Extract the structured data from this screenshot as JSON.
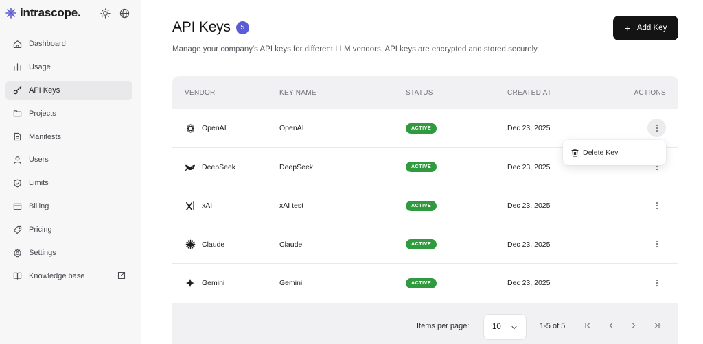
{
  "app": {
    "name": "intrascope."
  },
  "top_icons": [
    "sun-icon",
    "globe-icon"
  ],
  "sidebar": {
    "items": [
      {
        "label": "Dashboard",
        "icon": "home-icon"
      },
      {
        "label": "Usage",
        "icon": "bar-chart-icon"
      },
      {
        "label": "API Keys",
        "icon": "key-icon",
        "active": true
      },
      {
        "label": "Projects",
        "icon": "folder-icon"
      },
      {
        "label": "Manifests",
        "icon": "document-icon"
      },
      {
        "label": "Users",
        "icon": "user-icon"
      },
      {
        "label": "Limits",
        "icon": "shield-icon"
      },
      {
        "label": "Billing",
        "icon": "credit-card-icon"
      },
      {
        "label": "Pricing",
        "icon": "tag-icon"
      },
      {
        "label": "Settings",
        "icon": "gear-icon"
      },
      {
        "label": "Knowledge base",
        "icon": "book-icon",
        "external": true
      }
    ]
  },
  "header": {
    "title": "API Keys",
    "count": "5",
    "subtitle": "Manage your company's API keys for different LLM vendors. API keys are encrypted and stored securely.",
    "add_button": "Add Key"
  },
  "table": {
    "columns": [
      "VENDOR",
      "KEY NAME",
      "STATUS",
      "CREATED AT",
      "ACTIONS"
    ],
    "rows": [
      {
        "vendor": "OpenAI",
        "icon": "openai-icon",
        "key_name": "OpenAI",
        "status": "ACTIVE",
        "created_at": "Dec 23, 2025"
      },
      {
        "vendor": "DeepSeek",
        "icon": "deepseek-icon",
        "key_name": "DeepSeek",
        "status": "ACTIVE",
        "created_at": "Dec 23, 2025"
      },
      {
        "vendor": "xAI",
        "icon": "xai-icon",
        "key_name": "xAI test",
        "status": "ACTIVE",
        "created_at": "Dec 23, 2025"
      },
      {
        "vendor": "Claude",
        "icon": "claude-icon",
        "key_name": "Claude",
        "status": "ACTIVE",
        "created_at": "Dec 23, 2025"
      },
      {
        "vendor": "Gemini",
        "icon": "gemini-icon",
        "key_name": "Gemini",
        "status": "ACTIVE",
        "created_at": "Dec 23, 2025"
      }
    ]
  },
  "row_menu": {
    "delete_label": "Delete Key"
  },
  "pagination": {
    "items_per_page_label": "Items per page:",
    "items_per_page": "10",
    "range": "1-5 of 5"
  },
  "colors": {
    "accent": "#5b5bd6",
    "status_active": "#2f9b3e",
    "primary_button": "#141414"
  }
}
